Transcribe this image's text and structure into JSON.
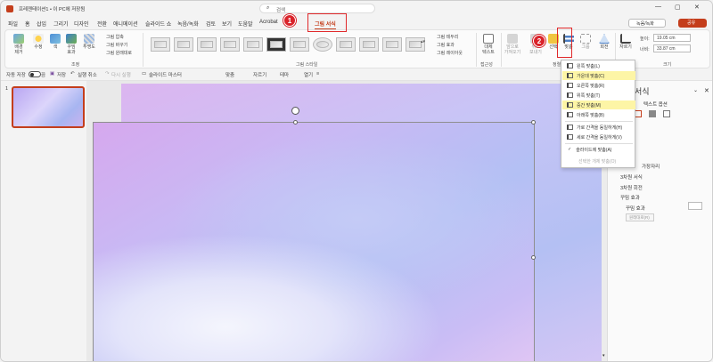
{
  "titlebar": {
    "doc_title": "프레젠테이션1 • 이 PC에 저장됨",
    "search_placeholder": "검색"
  },
  "menubar": {
    "tabs": [
      "파일",
      "홈",
      "삽입",
      "그리기",
      "디자인",
      "전환",
      "애니메이션",
      "슬라이드 쇼",
      "녹음/녹화",
      "검토",
      "보기",
      "도움말",
      "Acrobat"
    ],
    "active_tab": "그림 서식",
    "record_button": "녹음/녹화",
    "share_button": "공유"
  },
  "ribbon": {
    "adjust": {
      "group_label": "조정",
      "remove_bg": "배경\n제거",
      "corrections": "수정",
      "color": "색",
      "artistic": "꾸밈\n효과",
      "transparency": "투명도",
      "compress": "그림 압축",
      "change": "그림 바꾸기",
      "reset": "그림 원래대로"
    },
    "styles": {
      "group_label": "그림 스타일",
      "border": "그림 테두리",
      "effects": "그림 효과",
      "layout": "그림 레이아웃"
    },
    "accessibility": {
      "group_label": "접근성",
      "alt_text": "대체\n텍스트"
    },
    "arrange": {
      "group_label": "정렬",
      "bring_forward": "앞으로\n가져오기",
      "send_backward": "뒤로\n보내기",
      "selection": "선택",
      "align": "맞춤",
      "group": "그룹",
      "rotate": "회전"
    },
    "size": {
      "group_label": "크기",
      "crop": "자르기",
      "height_label": "높이:",
      "height_value": "19.05 cm",
      "width_label": "너비:",
      "width_value": "33.87 cm"
    }
  },
  "qat": {
    "autosave": "자동 저장",
    "autosave_state": "끔",
    "save": "저장",
    "undo": "실행 취소",
    "redo": "다시 실행",
    "slide_master": "슬라이드 마스터",
    "align": "맞춤",
    "crop": "자르기",
    "theme": "테마",
    "open": "열기"
  },
  "slide_panel": {
    "slide_number": "1"
  },
  "align_menu": {
    "items": [
      {
        "label": "왼쪽 맞춤(L)",
        "highlight": false,
        "disabled": false
      },
      {
        "label": "가운데 맞춤(C)",
        "highlight": true,
        "disabled": false
      },
      {
        "label": "오른쪽 맞춤(R)",
        "highlight": false,
        "disabled": false
      },
      {
        "label": "위쪽 맞춤(T)",
        "highlight": false,
        "disabled": false
      },
      {
        "label": "중간 맞춤(M)",
        "highlight": true,
        "disabled": false
      },
      {
        "label": "아래쪽 맞춤(B)",
        "highlight": false,
        "disabled": false
      },
      {
        "label": "가로 간격을 동일하게(H)",
        "highlight": false,
        "disabled": false
      },
      {
        "label": "세로 간격을 동일하게(V)",
        "highlight": false,
        "disabled": false
      },
      {
        "label": "슬라이드에 맞춤(A)",
        "highlight": false,
        "disabled": false,
        "checked": true
      },
      {
        "label": "선택한 개체 맞춤(O)",
        "highlight": false,
        "disabled": true
      }
    ]
  },
  "format_pane": {
    "title": "서식",
    "sub": "텍스트 옵션",
    "item1": "가장자리",
    "item2": "3차원 서식",
    "item3": "3차원 회전",
    "item4": "꾸밈 효과",
    "item5": "꾸밈 효과",
    "reset": "원래대로(R)"
  },
  "annotations": {
    "badge1": "1",
    "badge2": "2"
  }
}
